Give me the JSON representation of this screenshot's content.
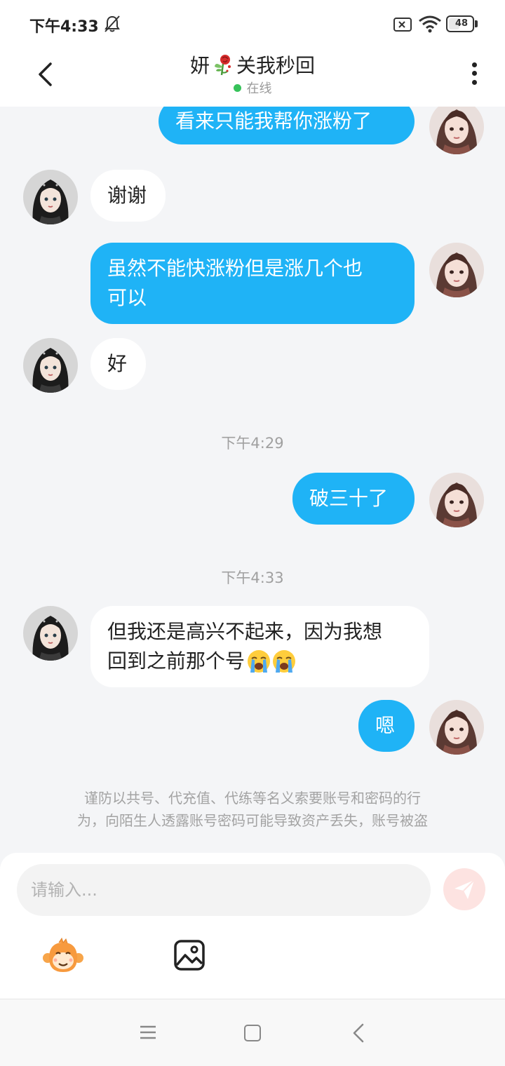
{
  "status_bar": {
    "time": "下午4:33",
    "battery": "48",
    "battery_fraction": 0.48
  },
  "header": {
    "title_left": "妍",
    "title_right": "关我秒回",
    "title_icon": "rose-icon",
    "status": "在线",
    "status_color": "#37c25a"
  },
  "messages": [
    {
      "side": "out",
      "text": "看来只能我帮你涨粉了"
    },
    {
      "side": "in",
      "text": "谢谢"
    },
    {
      "side": "out",
      "lines": [
        "虽然不能快涨粉但是涨几个也",
        "可以"
      ]
    },
    {
      "side": "in",
      "text": "好"
    },
    {
      "type": "time",
      "text": "下午4:29"
    },
    {
      "side": "out",
      "text": "破三十了"
    },
    {
      "type": "time",
      "text": "下午4:33"
    },
    {
      "side": "in",
      "lines": [
        "但我还是高兴不起来，因为我想",
        "回到之前那个号"
      ],
      "emoji": [
        "crying-face-icon",
        "crying-face-icon"
      ]
    },
    {
      "side": "out",
      "text": "嗯"
    }
  ],
  "notice": {
    "lines": [
      "谨防以共号、代充值、代练等名义索要账号和密码的行",
      "为，向陌生人透露账号密码可能导致资产丢失，账号被盗"
    ]
  },
  "input": {
    "placeholder": "请输入..."
  },
  "colors": {
    "outgoing_bubble": "#1fb3f6",
    "incoming_bubble": "#ffffff",
    "background": "#f4f5f7"
  }
}
